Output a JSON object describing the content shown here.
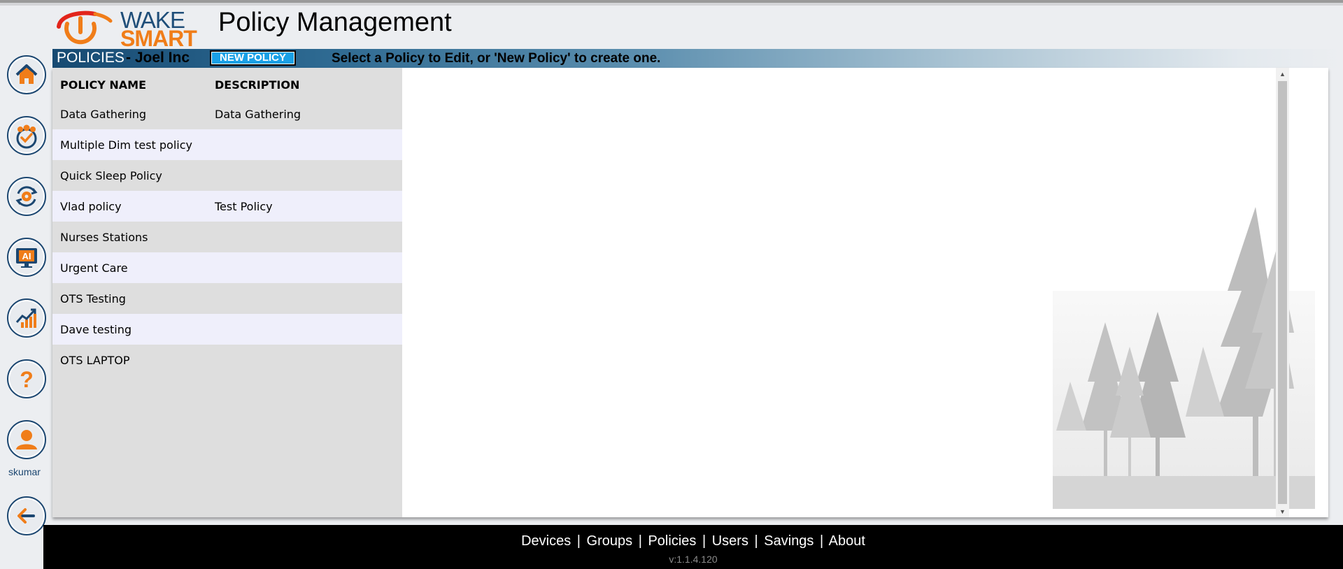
{
  "header": {
    "logo_wake": "WAKE",
    "logo_smart": "SMART",
    "title": "Policy Management"
  },
  "sidebar": {
    "items": [
      {
        "icon": "home-icon"
      },
      {
        "icon": "groups-icon"
      },
      {
        "icon": "settings-sync-icon"
      },
      {
        "icon": "ai-monitor-icon"
      },
      {
        "icon": "savings-chart-icon"
      },
      {
        "icon": "help-icon"
      },
      {
        "icon": "user-icon"
      },
      {
        "icon": "logout-icon"
      }
    ],
    "username": "skumar"
  },
  "policy_bar": {
    "title": "POLICIES",
    "company": "- Joel Inc",
    "new_policy_label": "NEW POLICY",
    "hint": "Select a Policy to Edit, or 'New Policy' to create one."
  },
  "table": {
    "headers": [
      "POLICY NAME",
      "DESCRIPTION"
    ],
    "rows": [
      {
        "name": "Data Gathering",
        "description": "Data Gathering"
      },
      {
        "name": "Multiple Dim test policy",
        "description": ""
      },
      {
        "name": "Quick Sleep Policy",
        "description": ""
      },
      {
        "name": "Vlad policy",
        "description": "Test Policy"
      },
      {
        "name": "Nurses Stations",
        "description": ""
      },
      {
        "name": "Urgent Care",
        "description": ""
      },
      {
        "name": "OTS Testing",
        "description": ""
      },
      {
        "name": "Dave testing",
        "description": ""
      },
      {
        "name": "OTS LAPTOP",
        "description": ""
      }
    ]
  },
  "footer": {
    "links": [
      "Devices",
      "Groups",
      "Policies",
      "Users",
      "Savings",
      "About"
    ],
    "separator": "|",
    "version": "v:1.1.4.120"
  },
  "colors": {
    "brand_blue": "#1b4670",
    "brand_orange": "#f07d19",
    "button_blue": "#1aa0e6"
  }
}
